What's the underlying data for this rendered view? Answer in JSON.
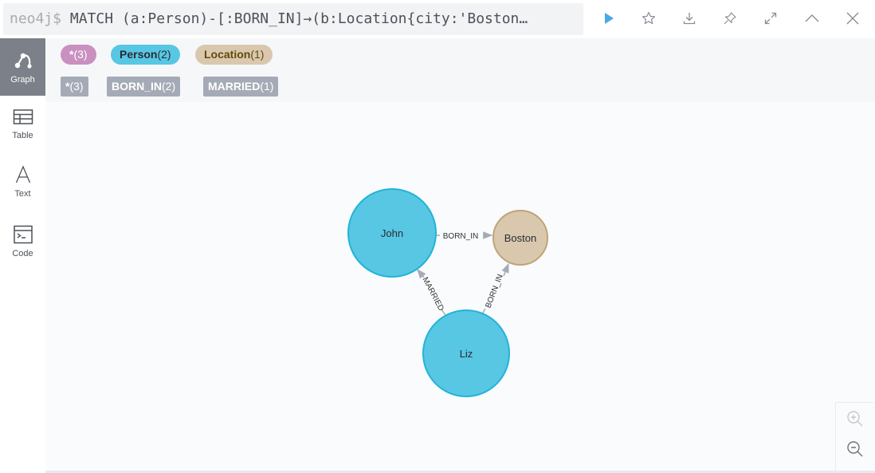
{
  "query": {
    "prompt": "neo4j$",
    "text": "MATCH (a:Person)-[:BORN_IN]→(b:Location{city:'Boston…"
  },
  "toolbar": {
    "run_icon": "play-icon",
    "favorite_icon": "star-icon",
    "download_icon": "download-icon",
    "pin_icon": "pin-icon",
    "fullscreen_icon": "expand-icon",
    "collapse_icon": "chevron-up-icon",
    "close_icon": "close-icon"
  },
  "sidenav": {
    "items": [
      {
        "label": "Graph",
        "icon": "graph-icon",
        "active": true
      },
      {
        "label": "Table",
        "icon": "table-icon",
        "active": false
      },
      {
        "label": "Text",
        "icon": "text-icon",
        "active": false
      },
      {
        "label": "Code",
        "icon": "code-icon",
        "active": false
      }
    ]
  },
  "legend": {
    "labels": [
      {
        "name": "*",
        "count": "(3)",
        "color": "#c990c0",
        "text_color": "#ffffff"
      },
      {
        "name": "Person",
        "count": "(2)",
        "color": "#57c7e3",
        "text_color": "#2a2c34"
      },
      {
        "name": "Location",
        "count": "(1)",
        "color": "#d9c8ae",
        "text_color": "#604a0e"
      }
    ],
    "relationships": [
      {
        "name": "*",
        "count": "(3)"
      },
      {
        "name": "BORN_IN",
        "count": "(2)"
      },
      {
        "name": "MARRIED",
        "count": "(1)"
      }
    ]
  },
  "graph": {
    "nodes": [
      {
        "id": "john",
        "caption": "John",
        "label": "Person",
        "color": "#57c7e3",
        "border": "#23b3d7"
      },
      {
        "id": "boston",
        "caption": "Boston",
        "label": "Location",
        "color": "#d9c8ae",
        "border": "#c0a378"
      },
      {
        "id": "liz",
        "caption": "Liz",
        "label": "Person",
        "color": "#57c7e3",
        "border": "#23b3d7"
      }
    ],
    "relationships": [
      {
        "from": "john",
        "to": "boston",
        "type": "BORN_IN"
      },
      {
        "from": "liz",
        "to": "boston",
        "type": "BORN_IN"
      },
      {
        "from": "liz",
        "to": "john",
        "type": "MARRIED"
      }
    ]
  },
  "zoom": {
    "in_icon": "zoom-in-icon",
    "out_icon": "zoom-out-icon"
  }
}
